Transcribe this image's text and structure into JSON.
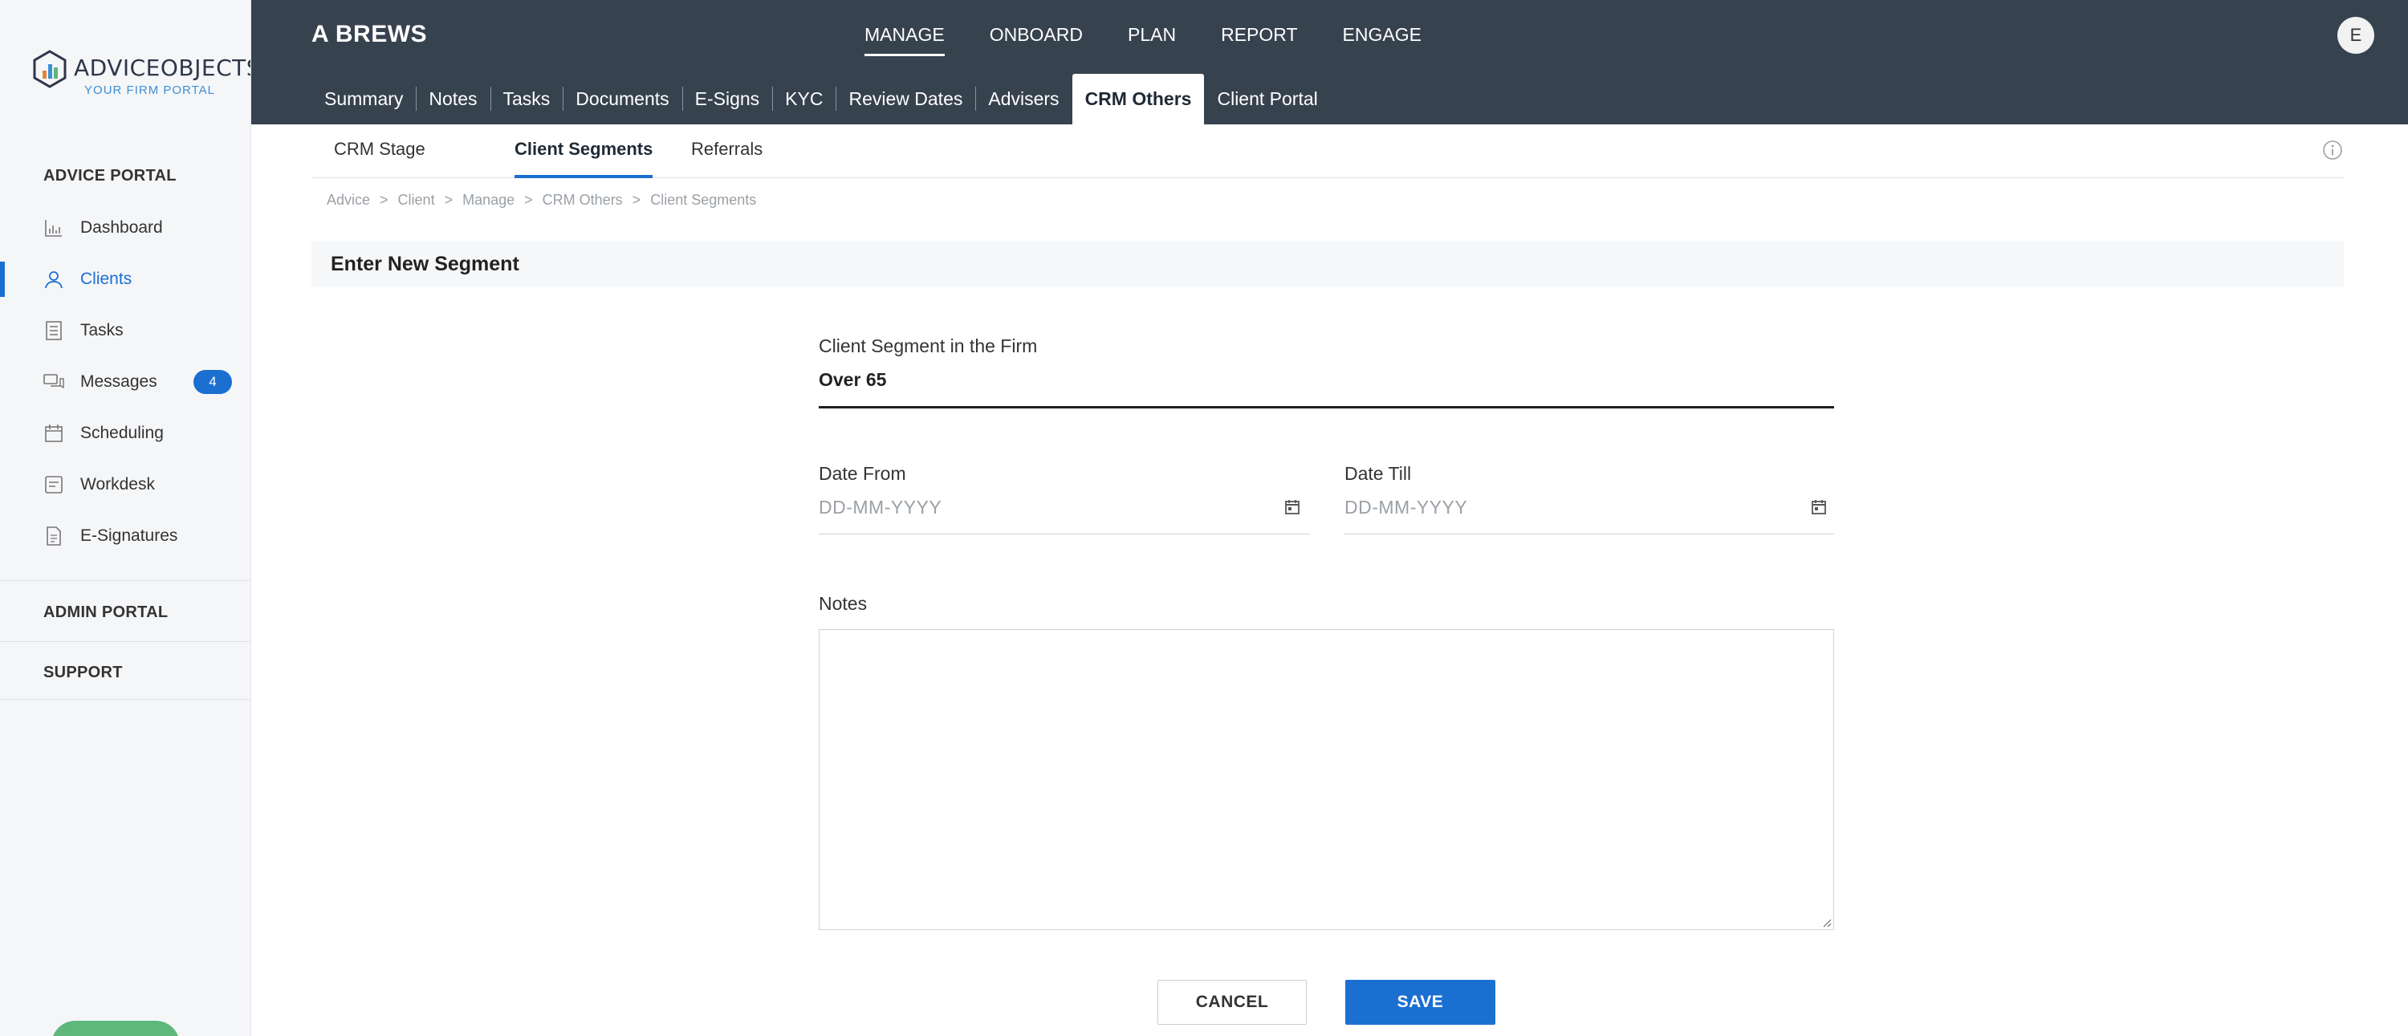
{
  "brand": {
    "name": "ADVICEOBJECTS",
    "tagline": "YOUR FIRM PORTAL"
  },
  "sidebar": {
    "advice_portal_title": "ADVICE PORTAL",
    "items": [
      {
        "label": "Dashboard",
        "icon": "bar-chart-icon"
      },
      {
        "label": "Clients",
        "icon": "user-icon",
        "active": true
      },
      {
        "label": "Tasks",
        "icon": "task-list-icon"
      },
      {
        "label": "Messages",
        "icon": "chat-icon",
        "badge": "4"
      },
      {
        "label": "Scheduling",
        "icon": "calendar-icon"
      },
      {
        "label": "Workdesk",
        "icon": "workdesk-icon"
      },
      {
        "label": "E-Signatures",
        "icon": "document-icon"
      }
    ],
    "admin_portal_title": "ADMIN PORTAL",
    "support_title": "SUPPORT"
  },
  "header": {
    "client_name": "A BREWS",
    "topnav": [
      "MANAGE",
      "ONBOARD",
      "PLAN",
      "REPORT",
      "ENGAGE"
    ],
    "avatar_initial": "E",
    "subtabs": [
      "Summary",
      "Notes",
      "Tasks",
      "Documents",
      "E-Signs",
      "KYC",
      "Review Dates",
      "Advisers",
      "CRM Others",
      "Client Portal"
    ]
  },
  "inner_tabs": [
    "CRM Stage",
    "Client Segments",
    "Referrals"
  ],
  "breadcrumb": [
    "Advice",
    ">",
    "Client",
    ">",
    "Manage",
    ">",
    "CRM Others",
    ">",
    "Client Segments"
  ],
  "form": {
    "title": "Enter New Segment",
    "segment_label": "Client Segment in the Firm",
    "segment_value": "Over 65",
    "date_from_label": "Date From",
    "date_from_placeholder": "DD-MM-YYYY",
    "date_till_label": "Date Till",
    "date_till_placeholder": "DD-MM-YYYY",
    "notes_label": "Notes",
    "notes_value": "",
    "cancel_label": "CANCEL",
    "save_label": "SAVE"
  },
  "colors": {
    "header_bg": "#37424f",
    "accent": "#1b6fd1",
    "sidebar_bg": "#f5f6f8"
  }
}
